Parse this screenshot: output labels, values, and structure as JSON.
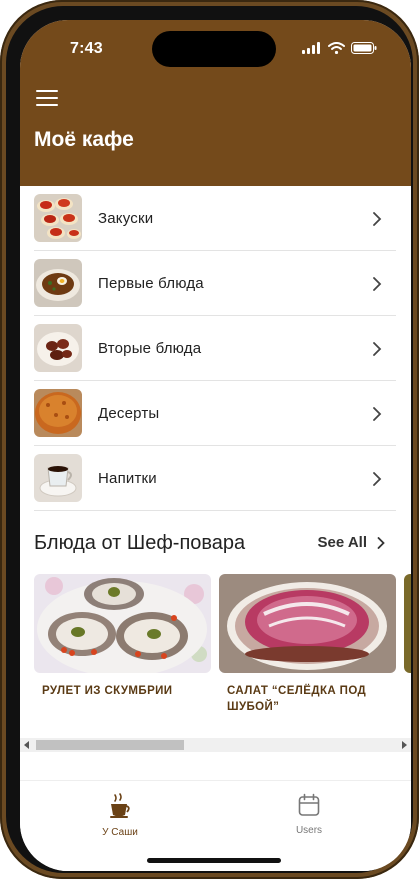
{
  "status": {
    "time": "7:43"
  },
  "header": {
    "title": "Моё кафе"
  },
  "categories": [
    {
      "label": "Закуски",
      "thumb": "caviar-canapes-photo"
    },
    {
      "label": "Первые блюда",
      "thumb": "soup-photo"
    },
    {
      "label": "Вторые блюда",
      "thumb": "main-dish-photo"
    },
    {
      "label": "Десерты",
      "thumb": "cake-photo"
    },
    {
      "label": "Напитки",
      "thumb": "tea-cup-photo"
    }
  ],
  "chef": {
    "title": "Блюда от Шеф-повара",
    "see_all": "See All",
    "items": [
      {
        "name": "РУЛЕТ ИЗ СКУМБРИИ"
      },
      {
        "name": "САЛАТ “СЕЛЁДКА ПОД ШУБОЙ”"
      }
    ]
  },
  "tabs": [
    {
      "label": "У Саши",
      "icon": "coffee-cup-icon",
      "active": true
    },
    {
      "label": "Users",
      "icon": "calendar-icon",
      "active": false
    }
  ],
  "colors": {
    "brand": "#744a1b",
    "active_tab": "#6b4216",
    "inactive_tab": "#777777"
  }
}
